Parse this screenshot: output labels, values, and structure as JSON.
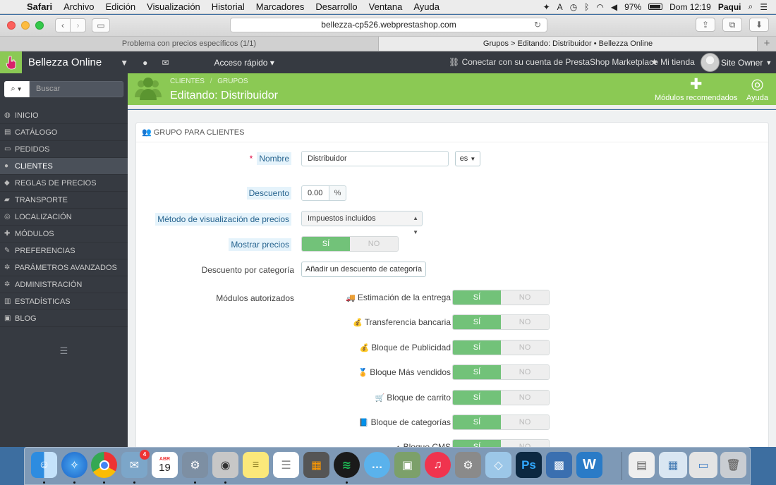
{
  "mac_menubar": {
    "apple": "",
    "app_name": "Safari",
    "menus": [
      "Archivo",
      "Edición",
      "Visualización",
      "Historial",
      "Marcadores",
      "Desarrollo",
      "Ventana",
      "Ayuda"
    ],
    "battery": "97%",
    "clock": "Dom 12:19",
    "user": "Paqui"
  },
  "safari": {
    "url": "bellezza-cp526.webprestashop.com",
    "tabs": [
      {
        "title": "Problema con precios específicos (1/1)"
      },
      {
        "title": "Grupos > Editando: Distribuidor • Bellezza Online"
      }
    ],
    "new_tab": "+"
  },
  "ps_header": {
    "shop_name": "Bellezza Online",
    "quick_access": "Acceso rápido",
    "marketplace": "Conectar con su cuenta de PrestaShop Marketplace",
    "my_shop": "Mi tienda",
    "owner": "Site Owner"
  },
  "sidebar": {
    "search_placeholder": "Buscar",
    "items": [
      {
        "label": "INICIO",
        "icon": "dashboard-icon",
        "glyph": "◍"
      },
      {
        "label": "CATÁLOGO",
        "icon": "book-icon",
        "glyph": "▤"
      },
      {
        "label": "PEDIDOS",
        "icon": "credit-card-icon",
        "glyph": "▭"
      },
      {
        "label": "CLIENTES",
        "icon": "users-icon",
        "glyph": "●"
      },
      {
        "label": "REGLAS DE PRECIOS",
        "icon": "tags-icon",
        "glyph": "◆"
      },
      {
        "label": "TRANSPORTE",
        "icon": "truck-icon",
        "glyph": "▰"
      },
      {
        "label": "LOCALIZACIÓN",
        "icon": "globe-icon",
        "glyph": "◎"
      },
      {
        "label": "MÓDULOS",
        "icon": "puzzle-icon",
        "glyph": "✚"
      },
      {
        "label": "PREFERENCIAS",
        "icon": "wrench-icon",
        "glyph": "✎"
      },
      {
        "label": "PARÁMETROS AVANZADOS",
        "icon": "cogs-icon",
        "glyph": "✲"
      },
      {
        "label": "ADMINISTRACIÓN",
        "icon": "cog-icon",
        "glyph": "✲"
      },
      {
        "label": "ESTADÍSTICAS",
        "icon": "bar-chart-icon",
        "glyph": "▥"
      },
      {
        "label": "BLOG",
        "icon": "blog-icon",
        "glyph": "▣"
      }
    ],
    "active_index": 3
  },
  "page_head": {
    "breadcrumb_1": "CLIENTES",
    "breadcrumb_sep": "/",
    "breadcrumb_2": "GRUPOS",
    "title": "Editando: Distribuidor",
    "recommended_modules": "Módulos recomendados",
    "help": "Ayuda"
  },
  "form": {
    "panel_title": "GRUPO PARA CLIENTES",
    "name_label": "Nombre",
    "name_value": "Distribuidor",
    "lang": "es",
    "discount_label": "Descuento",
    "discount_value": "0.00",
    "discount_unit": "%",
    "price_display_label": "Método de visualización de precios",
    "price_display_value": "Impuestos incluidos",
    "show_prices_label": "Mostrar precios",
    "switch_yes": "SÍ",
    "switch_no": "NO",
    "category_discount_label": "Descuento por categoría",
    "category_discount_button": "Añadir un descuento de categoría",
    "modules_label": "Módulos autorizados",
    "modules": [
      {
        "name": "Estimación de la entrega",
        "icon": "delivery-truck-icon",
        "glyph": "🚚"
      },
      {
        "name": "Transferencia bancaria",
        "icon": "coins-icon",
        "glyph": "💰"
      },
      {
        "name": "Bloque de Publicidad",
        "icon": "coins-icon",
        "glyph": "💰"
      },
      {
        "name": "Bloque Más vendidos",
        "icon": "award-icon",
        "glyph": "🏅"
      },
      {
        "name": "Bloque de carrito",
        "icon": "cart-icon",
        "glyph": "🛒"
      },
      {
        "name": "Bloque de categorías",
        "icon": "book-icon",
        "glyph": "📘"
      },
      {
        "name": "Bloque CMS",
        "icon": "cms-icon",
        "glyph": "◐"
      }
    ]
  },
  "dock": {
    "calendar_month": "ABR",
    "calendar_day": "19",
    "mail_badge": "4",
    "photoshop": "Ps",
    "word": "W"
  }
}
